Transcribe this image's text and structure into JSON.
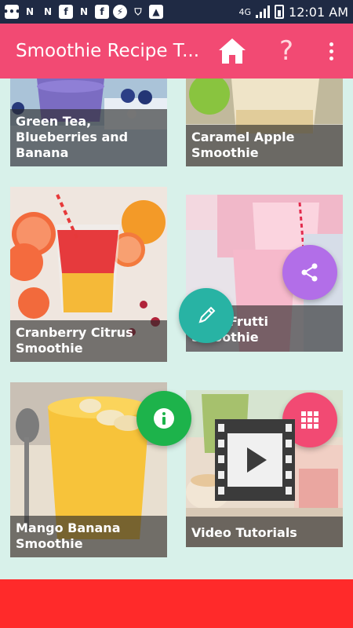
{
  "status_bar": {
    "time": "12:01 AM",
    "icons": [
      "chat-icon",
      "n-icon",
      "n-icon",
      "facebook-icon",
      "n-icon",
      "facebook-icon",
      "messenger-icon",
      "shield-icon",
      "image-icon",
      "data-icon",
      "signal-icon",
      "battery-icon"
    ]
  },
  "app_bar": {
    "title": "Smoothie Recipe T...",
    "home_icon": "home-icon",
    "help_label": "?",
    "menu_icon": "more-vert-icon",
    "colors": {
      "background": "#f24a73"
    }
  },
  "recipes": [
    {
      "label": "Green Tea, Blueberries and Banana",
      "image_icon": "green-tea-blueberry-smoothie-image"
    },
    {
      "label": "Caramel Apple Smoothie",
      "image_icon": "caramel-apple-smoothie-image"
    },
    {
      "label": "Cranberry Citrus Smoothie",
      "image_icon": "cranberry-citrus-smoothie-image"
    },
    {
      "label": "Tutti-Frutti Smoothie",
      "image_icon": "tutti-frutti-smoothie-image"
    },
    {
      "label": "Mango Banana Smoothie",
      "image_icon": "mango-banana-smoothie-image"
    },
    {
      "label": "Video Tutorials",
      "image_icon": "video-tutorials-image"
    }
  ],
  "fabs": {
    "share": {
      "icon": "share-icon",
      "color": "#b26ee8"
    },
    "edit": {
      "icon": "pencil-icon",
      "color": "#28b3a4"
    },
    "info": {
      "icon": "info-icon",
      "color": "#1db34b"
    },
    "apps": {
      "icon": "grid-icon",
      "color": "#f24a73"
    },
    "video": {
      "icon": "film-play-icon",
      "color": "#3b3b3b"
    }
  },
  "colors": {
    "page_background": "#d8f1ea",
    "bottom_bar": "#ff2a2a"
  }
}
